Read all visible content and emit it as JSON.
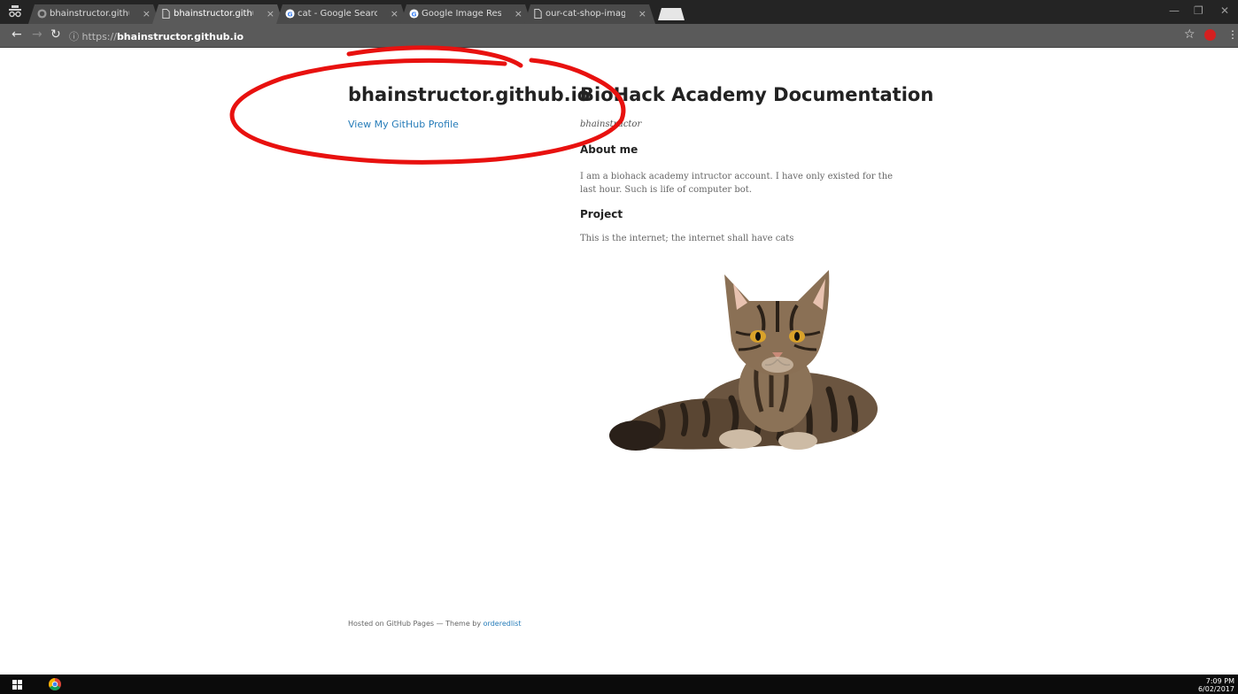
{
  "browser": {
    "tabs": [
      {
        "label": "bhainstructor.github.io/i",
        "icon": "github-icon",
        "active": false
      },
      {
        "label": "bhainstructor.github.io b",
        "icon": "page-icon",
        "active": true
      },
      {
        "label": "cat - Google Search",
        "icon": "google-icon",
        "active": false
      },
      {
        "label": "Google Image Result for",
        "icon": "google-icon",
        "active": false
      },
      {
        "label": "our-cat-shop-image.png",
        "icon": "page-icon",
        "active": false
      }
    ],
    "tab_close": "×",
    "url_scheme": "https://",
    "url_host": "bhainstructor.github.io",
    "window_controls": {
      "minimize": "—",
      "restore": "❐",
      "close": "✕"
    }
  },
  "page": {
    "site_title": "bhainstructor.github.io",
    "profile_link": "View My GitHub Profile",
    "doc_title": "BioHack Academy Documentation",
    "author": "bhainstructor",
    "about_heading": "About me",
    "about_text": "I am a biohack academy intructor account. I have only existed for the last hour. Such is life of computer bot.",
    "project_heading": "Project",
    "project_text": "This is the internet; the internet shall have cats",
    "footer_prefix": "Hosted on GitHub Pages — Theme by ",
    "footer_link": "orderedlist"
  },
  "taskbar": {
    "time": "7:09 PM",
    "date": "6/02/2017"
  },
  "colors": {
    "link": "#267CB9",
    "annotation": "#e8110f",
    "tabstrip": "#242424",
    "toolbar": "#5a5a5a"
  }
}
